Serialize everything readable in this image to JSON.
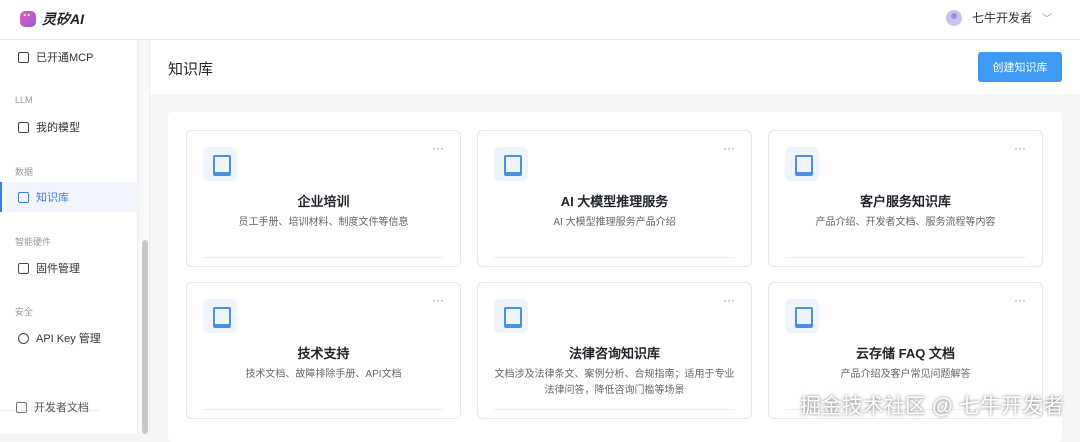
{
  "app": {
    "name": "灵矽AI"
  },
  "user": {
    "name": "七牛开发者"
  },
  "sidebar": {
    "items": [
      {
        "label": "已开通MCP",
        "icon": "clipboard-icon"
      },
      {
        "group": "LLM",
        "label": "我的模型",
        "icon": "message-icon"
      },
      {
        "group": "数据",
        "label": "知识库",
        "icon": "book-icon",
        "active": true
      },
      {
        "group": "智能硬件",
        "label": "固件管理",
        "icon": "upload-icon"
      },
      {
        "group": "安全",
        "label": "API Key 管理",
        "icon": "key-icon"
      }
    ],
    "footer": "开发者文档"
  },
  "page": {
    "title": "知识库",
    "create_label": "创建知识库"
  },
  "cards": [
    {
      "title": "企业培训",
      "desc": "员工手册、培训材料、制度文件等信息"
    },
    {
      "title": "AI 大模型推理服务",
      "desc": "AI 大模型推理服务产品介绍"
    },
    {
      "title": "客户服务知识库",
      "desc": "产品介绍、开发者文档、服务流程等内容"
    },
    {
      "title": "技术支持",
      "desc": "技术文档、故障排除手册、API文档"
    },
    {
      "title": "法律咨询知识库",
      "desc": "文档涉及法律条文、案例分析、合规指南；适用于专业法律问答，降低咨询门槛等场景"
    },
    {
      "title": "云存储 FAQ 文档",
      "desc": "产品介绍及客户常见问题解答"
    }
  ],
  "more_label": "···",
  "watermark": "掘金技术社区 @ 七牛开发者"
}
